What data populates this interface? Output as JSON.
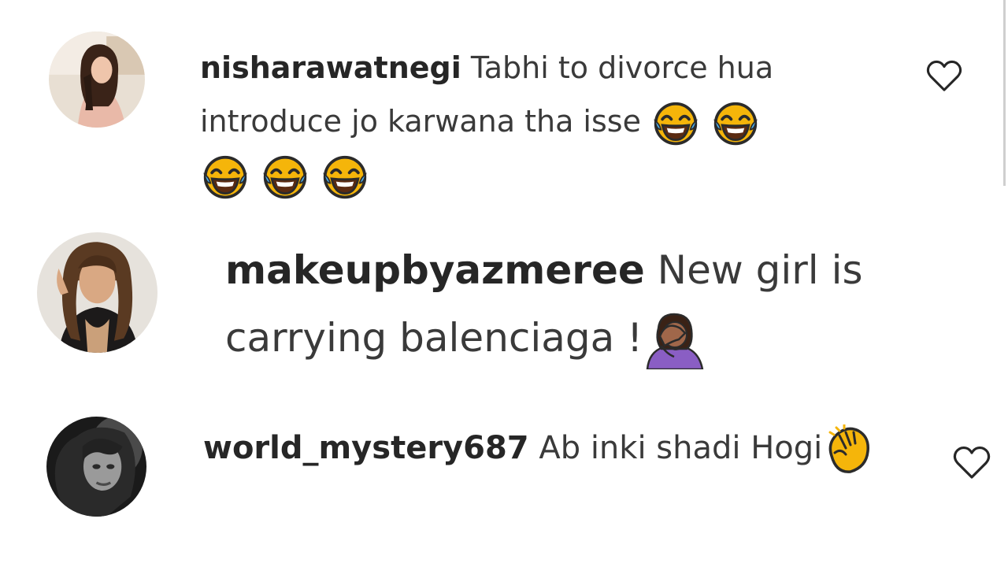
{
  "comments": [
    {
      "username": "nisharawatnegi",
      "text": "Tabhi to divorce hua introduce jo karwana tha isse",
      "emojis": [
        "face-with-tears-of-joy-icon",
        "face-with-tears-of-joy-icon",
        "face-with-tears-of-joy-icon",
        "face-with-tears-of-joy-icon",
        "face-with-tears-of-joy-icon"
      ],
      "liked": false
    },
    {
      "username": "makeupbyazmeree",
      "text": "New girl is carrying balenciaga !",
      "emojis": [
        "woman-facepalming-icon"
      ],
      "liked": false
    },
    {
      "username": "world_mystery687",
      "text": "Ab inki shadi Hogi",
      "emojis": [
        "clapping-hands-icon"
      ],
      "liked": false
    }
  ],
  "colors": {
    "username": "#262626",
    "body": "#3a3a3a",
    "meta": "#8e8e8e",
    "heart_stroke": "#262626",
    "emoji_yellow": "#f5b50a",
    "emoji_tear": "#4fb3f0",
    "facepalm_shirt": "#8a5ec4",
    "facepalm_skin": "#a0674a"
  }
}
